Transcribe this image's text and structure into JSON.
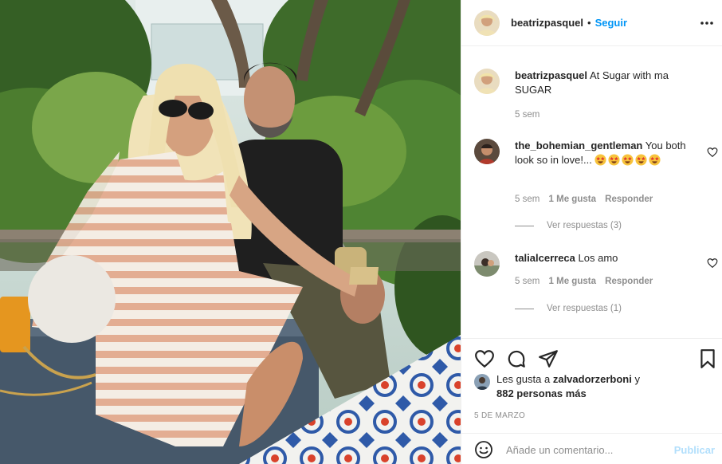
{
  "post": {
    "photo_alt": "foto-de-publicacion"
  },
  "header": {
    "username": "beatrizpasquel",
    "separator": "•",
    "follow_label": "Seguir",
    "more_icon": "more-horizontal-icon"
  },
  "caption": {
    "username": "beatrizpasquel",
    "text": "At Sugar with ma SUGAR",
    "time": "5 sem"
  },
  "comments": [
    {
      "username": "the_bohemian_gentleman",
      "text": "You both look so in love!...",
      "emoji": [
        "star-struck",
        "star-struck",
        "star-struck",
        "star-struck",
        "star-struck"
      ],
      "time": "5 sem",
      "likes": "1 Me gusta",
      "reply_label": "Responder",
      "view_replies": "Ver respuestas (3)"
    },
    {
      "username": "talialcerreca",
      "text": "Los amo",
      "emoji": [],
      "time": "5 sem",
      "likes": "1 Me gusta",
      "reply_label": "Responder",
      "view_replies": "Ver respuestas (1)"
    }
  ],
  "actions": {
    "icons": [
      "heart-icon",
      "comment-icon",
      "share-icon",
      "bookmark-icon"
    ]
  },
  "likes": {
    "prefix": "Les gusta a",
    "user": "zalvadorzerboni",
    "connector": "y",
    "others": "882 personas más"
  },
  "date": "5 DE MARZO",
  "add_comment": {
    "placeholder": "Añade un comentario...",
    "post_label": "Publicar"
  },
  "colors": {
    "accent": "#0095f6",
    "post_disabled": "#b2dffc",
    "muted": "#8e8e8e",
    "text": "#262626"
  }
}
